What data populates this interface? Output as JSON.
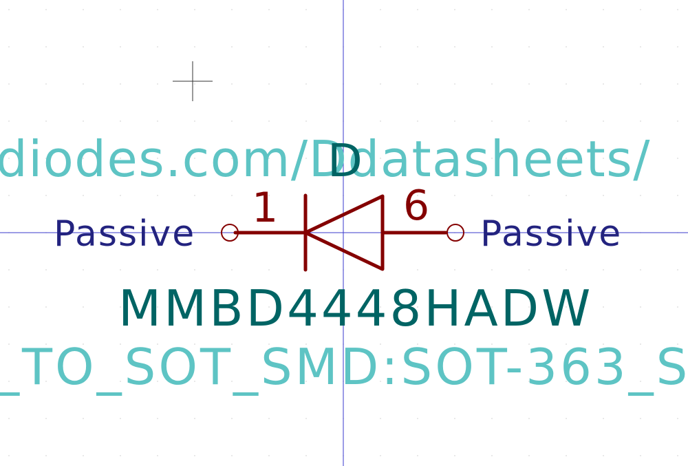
{
  "symbol": {
    "reference": "D",
    "value": "MMBD4448HADW",
    "datasheet_fragment": "diodes.com/Ddatasheets/",
    "footprint_fragment": "_TO_SOT_SMD:SOT-363_S",
    "pin_left": {
      "number": "1",
      "type": "Passive"
    },
    "pin_right": {
      "number": "6",
      "type": "Passive"
    }
  },
  "colors": {
    "background": "#ffffff",
    "grid_dot": "#d8d8d8",
    "axis": "#3a3acc",
    "body": "#840000",
    "pin_type_text": "#23237f",
    "reference_value_text": "#006464",
    "field_text": "#5ec4c4",
    "cursor": "#333333"
  }
}
